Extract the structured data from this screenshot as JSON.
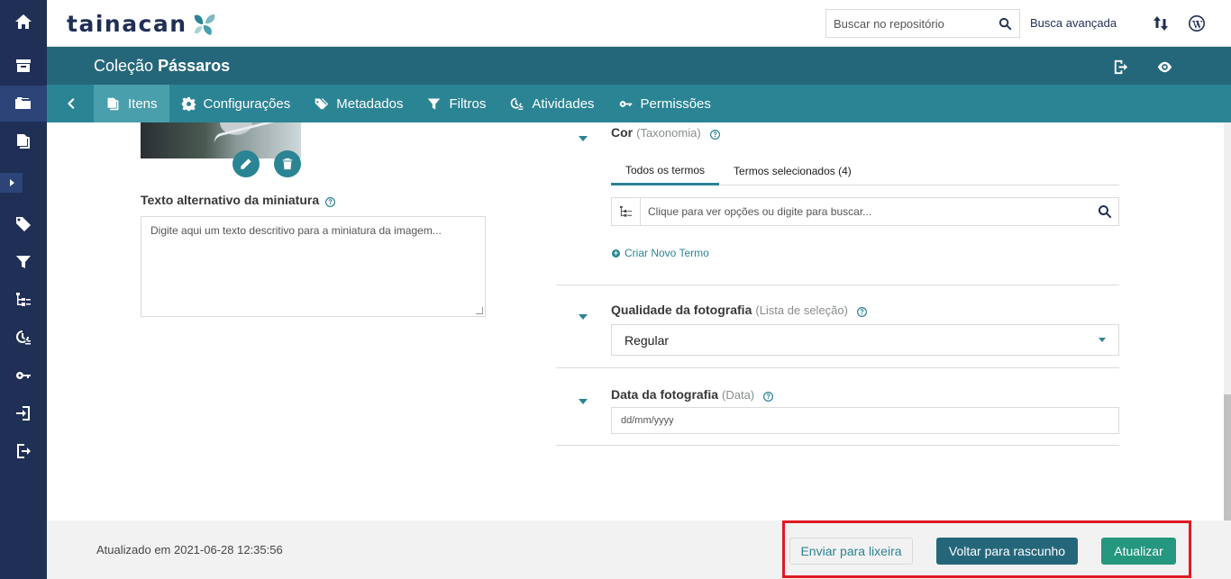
{
  "app": {
    "name": "Tainacan"
  },
  "topbar": {
    "search_placeholder": "Buscar no repositório",
    "advanced_search": "Busca avançada"
  },
  "collection": {
    "prefix": "Coleção",
    "name": "Pássaros"
  },
  "tabs": [
    {
      "label": "Itens",
      "icon": "items-icon"
    },
    {
      "label": "Configurações",
      "icon": "gear-icon"
    },
    {
      "label": "Metadados",
      "icon": "tag-icon"
    },
    {
      "label": "Filtros",
      "icon": "filter-icon"
    },
    {
      "label": "Atividades",
      "icon": "activities-icon"
    },
    {
      "label": "Permissões",
      "icon": "key-icon"
    }
  ],
  "thumbnail": {
    "alt_label": "Texto alternativo da miniatura",
    "alt_placeholder": "Digite aqui um texto descritivo para a miniatura da imagem..."
  },
  "metadata": {
    "cor": {
      "label": "Cor",
      "type": "(Taxonomia)",
      "subtab_all": "Todos os termos",
      "subtab_selected": "Termos selecionados (4)",
      "search_placeholder": "Clique para ver opções ou digite para buscar...",
      "new_term": "Criar Novo Termo"
    },
    "qualidade": {
      "label": "Qualidade da fotografia",
      "type": "(Lista de seleção)",
      "value": "Regular"
    },
    "data": {
      "label": "Data da fotografia",
      "type": "(Data)",
      "placeholder": "dd/mm/yyyy"
    }
  },
  "footer": {
    "updated": "Atualizado em 2021-06-28 12:35:56",
    "btn_trash": "Enviar para lixeira",
    "btn_draft": "Voltar para rascunho",
    "btn_update": "Atualizar"
  },
  "colors": {
    "sidebar": "#1f2f56",
    "collection_bar": "#25677a",
    "tabs_bar": "#2b8494",
    "update_button": "#25977e",
    "highlight": "#e01a22"
  }
}
